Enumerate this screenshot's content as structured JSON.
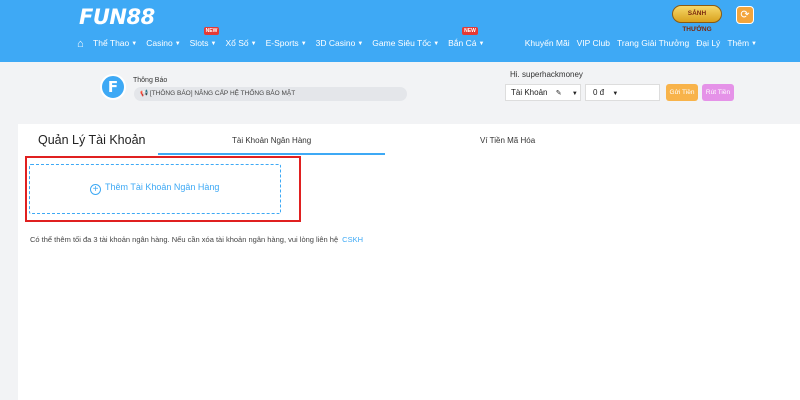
{
  "brand": {
    "logo": "FUN88",
    "badge": "SẢNH THƯỞNG",
    "accent": "#3ea9f5"
  },
  "nav": {
    "left": [
      {
        "label": "Thể Thao",
        "caret": true,
        "new": false
      },
      {
        "label": "Casino",
        "caret": true,
        "new": false
      },
      {
        "label": "Slots",
        "caret": true,
        "new": true
      },
      {
        "label": "Xổ Số",
        "caret": true,
        "new": false
      },
      {
        "label": "E-Sports",
        "caret": true,
        "new": false
      },
      {
        "label": "3D Casino",
        "caret": true,
        "new": false
      },
      {
        "label": "Game Siêu Tốc",
        "caret": true,
        "new": false
      },
      {
        "label": "Bắn Cá",
        "caret": true,
        "new": true
      }
    ],
    "right": [
      "Khuyến Mãi",
      "VIP Club",
      "Trang Giải Thưởng",
      "Đại Lý",
      "Thêm"
    ],
    "new_tag": "NEW"
  },
  "notice": {
    "avatar_letter": "F",
    "title": "Thông Báo",
    "message": "📢 [THÔNG BÁO] NÂNG CẤP HỆ THỐNG BẢO MẬT"
  },
  "account": {
    "greeting": "Hi. superhackmoney",
    "account_select": "Tài Khoản",
    "balance": "0 đ",
    "deposit": "Gửi Tiền",
    "withdraw": "Rút Tiền"
  },
  "panel": {
    "title": "Quản Lý Tài Khoản",
    "tab_bank": "Tài Khoản Ngân Hàng",
    "tab_crypto": "Ví Tiền Mã Hóa",
    "add_bank": "Thêm Tài Khoản Ngân Hàng",
    "info": "Có thể thêm tối đa 3 tài khoản ngân hàng. Nếu cần xóa tài khoản ngân hàng, vui lòng liên hệ",
    "info_link": "CSKH"
  }
}
